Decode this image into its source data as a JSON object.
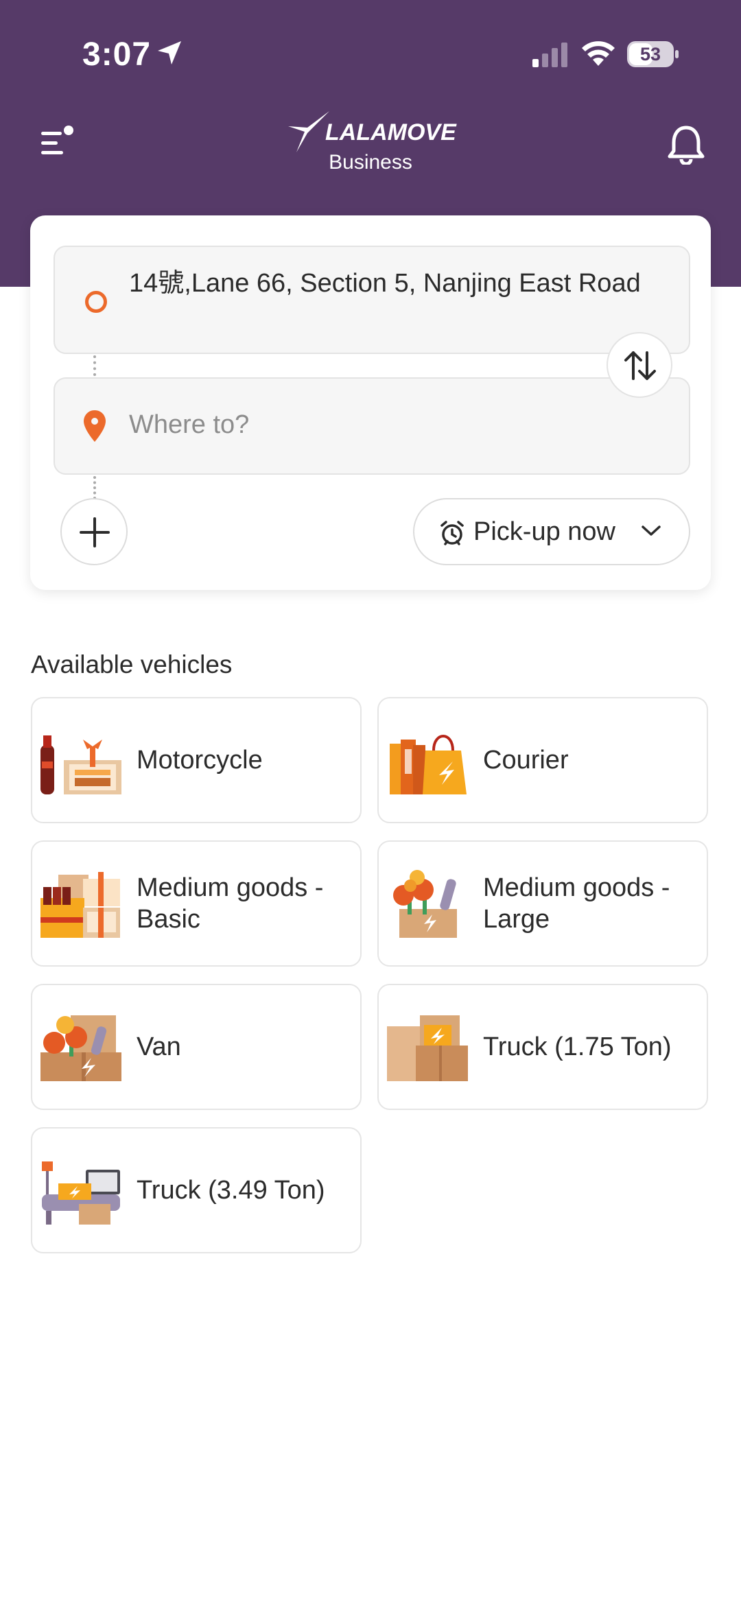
{
  "status_bar": {
    "time": "3:07",
    "battery": "53",
    "icons": [
      "location-arrow-icon",
      "signal-icon",
      "wifi-icon",
      "battery-icon"
    ]
  },
  "header": {
    "logo_text": "LALAMOVE",
    "logo_subtitle": "Business",
    "menu_icon": "menu-icon",
    "bell_icon": "bell-icon"
  },
  "route": {
    "pickup_address": "14號,Lane 66, Section 5, Nanjing East Road",
    "dropoff_placeholder": "Where to?",
    "swap_icon": "swap-icon",
    "add_stop_icon": "plus-icon",
    "pickup_time_label": "Pick-up now"
  },
  "vehicles": {
    "title": "Available vehicles",
    "items": [
      {
        "name": "Motorcycle"
      },
      {
        "name": "Courier"
      },
      {
        "name": "Medium goods - Basic"
      },
      {
        "name": "Medium goods - Large"
      },
      {
        "name": "Van"
      },
      {
        "name": "Truck (1.75 Ton)"
      },
      {
        "name": "Truck (3.49 Ton)"
      }
    ]
  },
  "colors": {
    "brand_purple": "#563a68",
    "accent_orange": "#ec6a2b"
  }
}
